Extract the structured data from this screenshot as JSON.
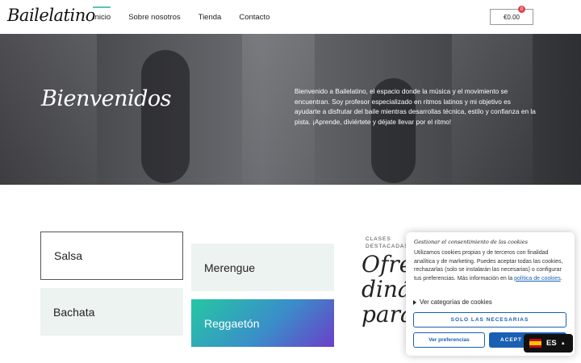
{
  "header": {
    "logo": "Bailelatino",
    "nav": [
      {
        "label": "Inicio",
        "active": true
      },
      {
        "label": "Sobre nosotros",
        "active": false
      },
      {
        "label": "Tienda",
        "active": false
      },
      {
        "label": "Contacto",
        "active": false
      }
    ],
    "cart": {
      "total": "€0.00",
      "count": "0"
    }
  },
  "hero": {
    "title": "Bienvenidos",
    "text": "Bienvenido a Bailelatino, el espacio donde la música y el movimiento se encuentran. Soy profesor especializado en ritmos latinos y mi objetivo es ayudarte a disfrutar del baile mientras desarrollas técnica, estilo y confianza en la pista. ¡Aprende, diviértete y déjate llevar por el ritmo!"
  },
  "classes": {
    "cards": [
      "Salsa",
      "Bachata",
      "Merengue",
      "Reggaetón"
    ],
    "kicker": "CLASES DESTACADAS",
    "title_lines": [
      "Ofrez",
      "dinám",
      "para"
    ]
  },
  "cookie_banner": {
    "title": "Gestionar el consentimiento de las cookies",
    "body": "Utilizamos cookies propias y de terceros con finalidad analítica y de marketing. Puedes aceptar todas las cookies, rechazarlas (solo se instalarán las necesarias) o configurar tus preferencias. Más información en la",
    "policy_link": "política de cookies",
    "toggle_label": "Ver categorías de cookies",
    "btn_necessary": "SOLO LAS NECESARIAS",
    "btn_preferences": "Ver preferencias",
    "btn_accept": "ACEPT"
  },
  "language": {
    "code": "ES",
    "flag": "spain-flag-icon"
  },
  "colors": {
    "accent": "#5bc4c0",
    "link": "#1a5fb4",
    "card_bg": "#edf3f1",
    "badge": "#e0434d"
  }
}
